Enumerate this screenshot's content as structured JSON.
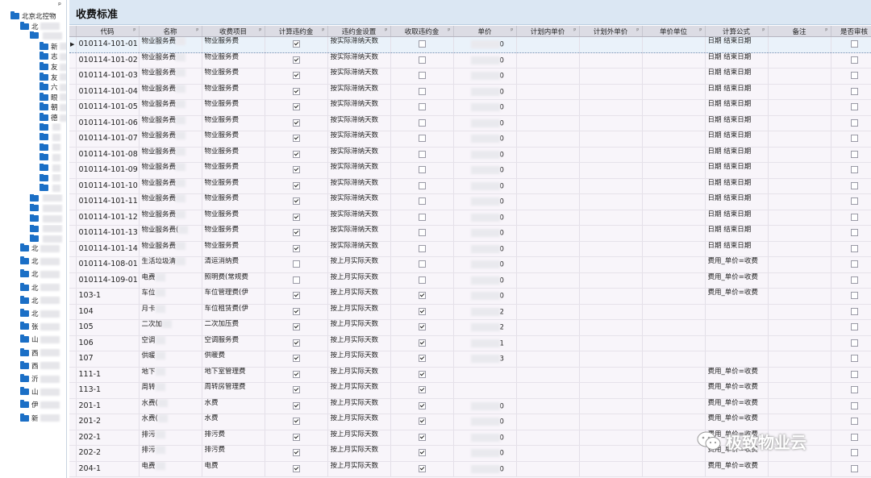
{
  "page_title": "收费标准",
  "tree": {
    "pin_glyph": "ᵖ",
    "items": [
      {
        "label": "北京北控物",
        "indent": 1
      },
      {
        "label": "北",
        "indent": 2
      },
      {
        "label": "",
        "indent": 3
      },
      {
        "label": "新",
        "indent": 4
      },
      {
        "label": "志",
        "indent": 4
      },
      {
        "label": "友",
        "indent": 4
      },
      {
        "label": "友",
        "indent": 4
      },
      {
        "label": "六",
        "indent": 4
      },
      {
        "label": "眼",
        "indent": 4
      },
      {
        "label": "朝",
        "indent": 4
      },
      {
        "label": "德",
        "indent": 4
      },
      {
        "label": "",
        "indent": 4
      },
      {
        "label": "",
        "indent": 4
      },
      {
        "label": "",
        "indent": 4
      },
      {
        "label": "",
        "indent": 4
      },
      {
        "label": "",
        "indent": 4
      },
      {
        "label": "",
        "indent": 4
      },
      {
        "label": "",
        "indent": 4
      },
      {
        "label": "",
        "indent": 3
      },
      {
        "label": "",
        "indent": 3
      },
      {
        "label": "",
        "indent": 3
      },
      {
        "label": "",
        "indent": 3
      },
      {
        "label": "",
        "indent": 3
      },
      {
        "label": "北",
        "indent": 2
      },
      {
        "label": "北",
        "indent": 2
      },
      {
        "label": "北",
        "indent": 2
      },
      {
        "label": "北",
        "indent": 2
      },
      {
        "label": "北",
        "indent": 2
      },
      {
        "label": "北",
        "indent": 2
      },
      {
        "label": "张",
        "indent": 2
      },
      {
        "label": "山",
        "indent": 2
      },
      {
        "label": "西",
        "indent": 2
      },
      {
        "label": "西",
        "indent": 2
      },
      {
        "label": "沂",
        "indent": 2
      },
      {
        "label": "山",
        "indent": 2
      },
      {
        "label": "伊",
        "indent": 2
      },
      {
        "label": "新",
        "indent": 2
      }
    ]
  },
  "grid": {
    "columns": [
      {
        "label": "代码",
        "width": 78
      },
      {
        "label": "名称",
        "width": 78
      },
      {
        "label": "收费项目",
        "width": 78
      },
      {
        "label": "计算违约金",
        "width": 78
      },
      {
        "label": "违约金设置",
        "width": 78
      },
      {
        "label": "收取违约金",
        "width": 78
      },
      {
        "label": "单价",
        "width": 78
      },
      {
        "label": "计划内单价",
        "width": 78
      },
      {
        "label": "计划外单价",
        "width": 78
      },
      {
        "label": "单价单位",
        "width": 78
      },
      {
        "label": "计算公式",
        "width": 78
      },
      {
        "label": "备注",
        "width": 78
      },
      {
        "label": "是否审核",
        "width": 58
      }
    ],
    "pin_glyph": "ᵖ",
    "rows": [
      {
        "code": "010114-101-01",
        "name": "物业服务费",
        "item": "物业服务费",
        "calc": true,
        "setting": "按实际滞纳天数",
        "collect": false,
        "price": "0",
        "formula": "日期 结束日期"
      },
      {
        "code": "010114-101-02",
        "name": "物业服务费",
        "item": "物业服务费",
        "calc": true,
        "setting": "按实际滞纳天数",
        "collect": false,
        "price": "0",
        "formula": "日期 结束日期"
      },
      {
        "code": "010114-101-03",
        "name": "物业服务费",
        "item": "物业服务费",
        "calc": true,
        "setting": "按实际滞纳天数",
        "collect": false,
        "price": "0",
        "formula": "日期 结束日期"
      },
      {
        "code": "010114-101-04",
        "name": "物业服务费",
        "item": "物业服务费",
        "calc": true,
        "setting": "按实际滞纳天数",
        "collect": false,
        "price": "0",
        "formula": "日期 结束日期"
      },
      {
        "code": "010114-101-05",
        "name": "物业服务费",
        "item": "物业服务费",
        "calc": true,
        "setting": "按实际滞纳天数",
        "collect": false,
        "price": "0",
        "formula": "日期 结束日期"
      },
      {
        "code": "010114-101-06",
        "name": "物业服务费",
        "item": "物业服务费",
        "calc": true,
        "setting": "按实际滞纳天数",
        "collect": false,
        "price": "0",
        "formula": "日期 结束日期"
      },
      {
        "code": "010114-101-07",
        "name": "物业服务费",
        "item": "物业服务费",
        "calc": true,
        "setting": "按实际滞纳天数",
        "collect": false,
        "price": "0",
        "formula": "日期 结束日期"
      },
      {
        "code": "010114-101-08",
        "name": "物业服务费",
        "item": "物业服务费",
        "calc": true,
        "setting": "按实际滞纳天数",
        "collect": false,
        "price": "0",
        "formula": "日期 结束日期"
      },
      {
        "code": "010114-101-09",
        "name": "物业服务费",
        "item": "物业服务费",
        "calc": true,
        "setting": "按实际滞纳天数",
        "collect": false,
        "price": "0",
        "formula": "日期 结束日期"
      },
      {
        "code": "010114-101-10",
        "name": "物业服务费",
        "item": "物业服务费",
        "calc": true,
        "setting": "按实际滞纳天数",
        "collect": false,
        "price": "0",
        "formula": "日期 结束日期"
      },
      {
        "code": "010114-101-11",
        "name": "物业服务费",
        "item": "物业服务费",
        "calc": true,
        "setting": "按实际滞纳天数",
        "collect": false,
        "price": "0",
        "formula": "日期 结束日期"
      },
      {
        "code": "010114-101-12",
        "name": "物业服务费",
        "item": "物业服务费",
        "calc": true,
        "setting": "按实际滞纳天数",
        "collect": false,
        "price": "0",
        "formula": "日期 结束日期"
      },
      {
        "code": "010114-101-13",
        "name": "物业服务费(",
        "item": "物业服务费",
        "calc": true,
        "setting": "按实际滞纳天数",
        "collect": false,
        "price": "0",
        "formula": "日期 结束日期"
      },
      {
        "code": "010114-101-14",
        "name": "物业服务费",
        "item": "物业服务费",
        "calc": true,
        "setting": "按实际滞纳天数",
        "collect": false,
        "price": "0",
        "formula": "日期 结束日期"
      },
      {
        "code": "010114-108-01",
        "name": "生活垃圾清",
        "item": "清运消纳费",
        "calc": false,
        "setting": "按上月实际天数",
        "collect": false,
        "price": "0",
        "formula": "费用_单价=收费"
      },
      {
        "code": "010114-109-01",
        "name": "电费",
        "item": "照明费(常规费",
        "calc": false,
        "setting": "按上月实际天数",
        "collect": false,
        "price": "0",
        "formula": "费用_单价=收费"
      },
      {
        "code": "103-1",
        "name": "车位",
        "item": "车位管理费(伊",
        "calc": true,
        "setting": "按上月实际天数",
        "collect": true,
        "price": "0",
        "formula": "费用_单价=收费"
      },
      {
        "code": "104",
        "name": "月卡",
        "item": "车位租赁费(伊",
        "calc": true,
        "setting": "按上月实际天数",
        "collect": true,
        "price": "2",
        "formula": ""
      },
      {
        "code": "105",
        "name": "二次加",
        "item": "二次加压费",
        "calc": true,
        "setting": "按上月实际天数",
        "collect": true,
        "price": "2",
        "formula": ""
      },
      {
        "code": "106",
        "name": "空调",
        "item": "空调服务费",
        "calc": true,
        "setting": "按上月实际天数",
        "collect": true,
        "price": "1",
        "formula": ""
      },
      {
        "code": "107",
        "name": "供暖",
        "item": "供暖费",
        "calc": true,
        "setting": "按上月实际天数",
        "collect": true,
        "price": "3",
        "formula": ""
      },
      {
        "code": "111-1",
        "name": "地下",
        "item": "地下室管理费",
        "calc": true,
        "setting": "按上月实际天数",
        "collect": true,
        "price": "",
        "formula": "费用_单价=收费"
      },
      {
        "code": "113-1",
        "name": "周转",
        "item": "周转房管理费",
        "calc": true,
        "setting": "按上月实际天数",
        "collect": true,
        "price": "",
        "formula": "费用_单价=收费"
      },
      {
        "code": "201-1",
        "name": "水费(",
        "item": "水费",
        "calc": true,
        "setting": "按上月实际天数",
        "collect": true,
        "price": "0",
        "formula": "费用_单价=收费"
      },
      {
        "code": "201-2",
        "name": "水费(",
        "item": "水费",
        "calc": true,
        "setting": "按上月实际天数",
        "collect": true,
        "price": "0",
        "formula": "费用_单价=收费"
      },
      {
        "code": "202-1",
        "name": "排污",
        "item": "排污费",
        "calc": true,
        "setting": "按上月实际天数",
        "collect": true,
        "price": "0",
        "formula": "费用_单价=收费"
      },
      {
        "code": "202-2",
        "name": "排污",
        "item": "排污费",
        "calc": true,
        "setting": "按上月实际天数",
        "collect": true,
        "price": "0",
        "formula": "费用_单价=收费"
      },
      {
        "code": "204-1",
        "name": "电费",
        "item": "电费",
        "calc": true,
        "setting": "按上月实际天数",
        "collect": true,
        "price": "0",
        "formula": "费用_单价=收费"
      }
    ]
  },
  "watermark": {
    "text": "极致物业云",
    "icon": "wechat-icon"
  }
}
